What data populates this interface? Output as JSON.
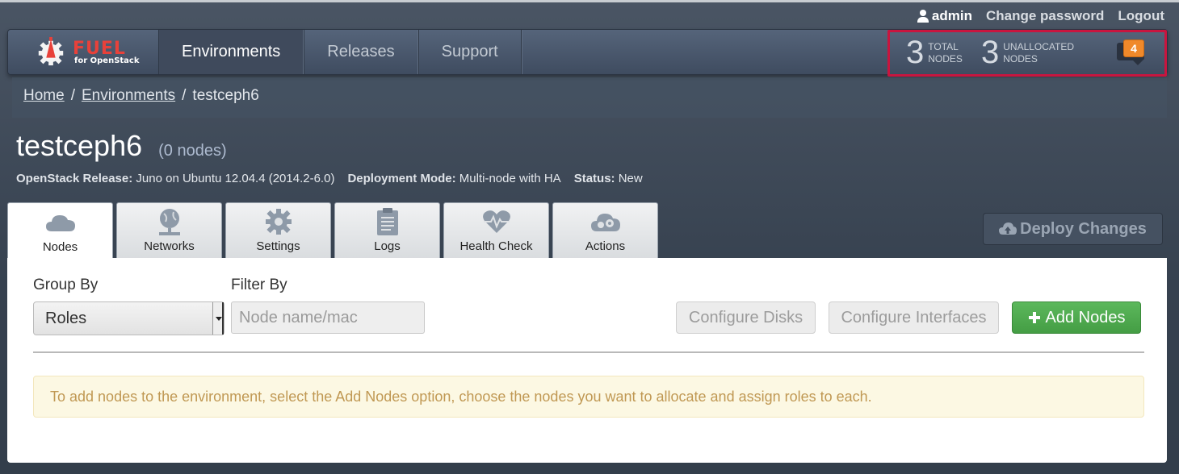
{
  "userbar": {
    "username": "admin",
    "change_password": "Change password",
    "logout": "Logout"
  },
  "logo": {
    "name": "FUEL",
    "subtitle": "for OpenStack"
  },
  "nav": [
    {
      "label": "Environments",
      "active": true
    },
    {
      "label": "Releases",
      "active": false
    },
    {
      "label": "Support",
      "active": false
    }
  ],
  "stats": {
    "total_count": "3",
    "total_label_1": "TOTAL",
    "total_label_2": "NODES",
    "unallocated_count": "3",
    "unallocated_label_1": "UNALLOCATED",
    "unallocated_label_2": "NODES",
    "notifications": "4"
  },
  "breadcrumb": {
    "home": "Home",
    "sep1": "/",
    "environments": "Environments",
    "sep2": "/",
    "current": "testceph6"
  },
  "cluster": {
    "name": "testceph6",
    "nodes": "(0 nodes)",
    "release_label": "OpenStack Release:",
    "release_value": "Juno on Ubuntu 12.04.4 (2014.2-6.0)",
    "mode_label": "Deployment Mode:",
    "mode_value": "Multi-node with HA",
    "status_label": "Status:",
    "status_value": "New"
  },
  "tabs": [
    {
      "label": "Nodes",
      "icon": "cloud-icon",
      "active": true
    },
    {
      "label": "Networks",
      "icon": "globe-network-icon",
      "active": false
    },
    {
      "label": "Settings",
      "icon": "gear-icon",
      "active": false
    },
    {
      "label": "Logs",
      "icon": "clipboard-icon",
      "active": false
    },
    {
      "label": "Health Check",
      "icon": "heartbeat-icon",
      "active": false
    },
    {
      "label": "Actions",
      "icon": "cloud-gears-icon",
      "active": false
    }
  ],
  "deploy_button": "Deploy Changes",
  "nodes_panel": {
    "group_by_label": "Group By",
    "group_by_value": "Roles",
    "filter_by_label": "Filter By",
    "filter_placeholder": "Node name/mac",
    "filter_value": "",
    "configure_disks": "Configure Disks",
    "configure_interfaces": "Configure Interfaces",
    "add_nodes": "Add Nodes",
    "alert": "To add nodes to the environment, select the Add Nodes option, choose the nodes you want to allocate and assign roles to each."
  },
  "colors": {
    "alert_text": "#c09853",
    "add_button": "#5cb85c",
    "highlight_border": "#c8153f",
    "badge": "#f0892a"
  }
}
